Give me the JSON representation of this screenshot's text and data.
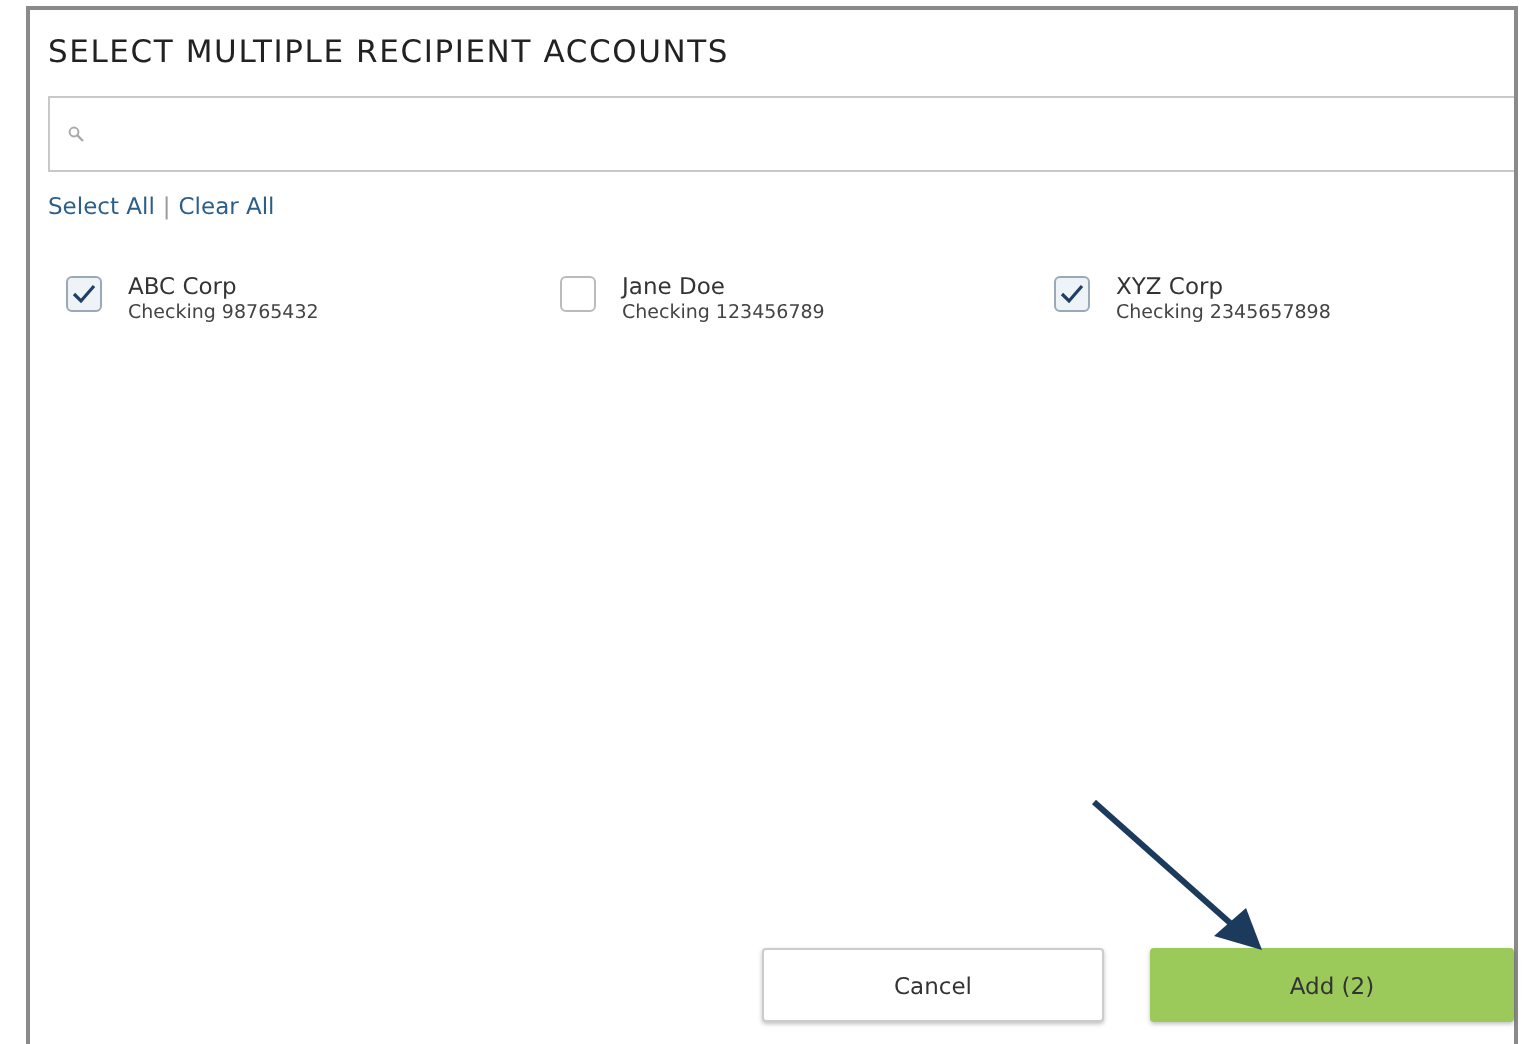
{
  "title": "SELECT MULTIPLE RECIPIENT ACCOUNTS",
  "links": [
    "Select All",
    "Clear All"
  ],
  "link_separator": "|",
  "accounts": [
    {
      "name": "ABC Corp",
      "detail": "Checking 98765432",
      "checked": true
    },
    {
      "name": "Jane Doe",
      "detail": "Checking 123456789",
      "checked": false
    },
    {
      "name": "XYZ Corp",
      "detail": "Checking 2345657898",
      "checked": true
    }
  ],
  "buttons": [
    {
      "label": "Cancel",
      "kind": "secondary"
    },
    {
      "label": "Add (2)",
      "kind": "primary"
    }
  ]
}
